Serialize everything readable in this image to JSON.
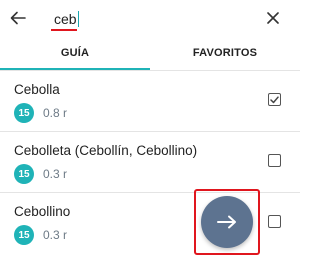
{
  "search": {
    "value": "ceb",
    "icons": {
      "back": "arrow-left-icon",
      "clear": "close-icon"
    }
  },
  "tabs": [
    {
      "label": "GUÍA",
      "active": true
    },
    {
      "label": "FAVORITOS",
      "active": false
    }
  ],
  "items": [
    {
      "name": "Cebolla",
      "badge": "15",
      "portion": "0.8 r",
      "checked": true
    },
    {
      "name": "Cebolleta (Cebollín, Cebollino)",
      "badge": "15",
      "portion": "0.3 r",
      "checked": false
    },
    {
      "name": "Cebollino",
      "badge": "15",
      "portion": "0.3 r",
      "checked": false
    }
  ],
  "fab": {
    "icon": "arrow-right-icon"
  },
  "colors": {
    "accent": "#1fb3b7",
    "highlight": "#e0161e",
    "fab": "#5d7390"
  }
}
